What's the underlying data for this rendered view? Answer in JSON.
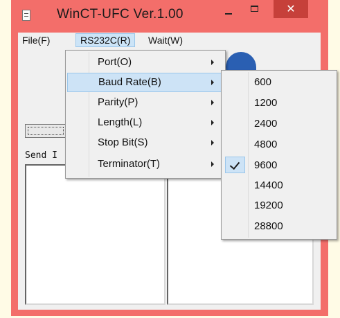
{
  "window": {
    "title": "WinCT-UFC  Ver.1.00",
    "close_glyph": "✕"
  },
  "menubar": {
    "items": [
      "File(F)",
      "RS232C(R)",
      "Wait(W)"
    ]
  },
  "main": {
    "send_label": "Send I"
  },
  "rs232c_menu": {
    "items": [
      "Port(O)",
      "Baud Rate(B)",
      "Parity(P)",
      "Length(L)",
      "Stop Bit(S)",
      "Terminator(T)"
    ],
    "highlighted": "Baud Rate(B)"
  },
  "baud_menu": {
    "items": [
      "600",
      "1200",
      "2400",
      "4800",
      "9600",
      "14400",
      "19200",
      "28800"
    ],
    "selected": "9600"
  },
  "colors": {
    "window_frame": "#f36e6a",
    "close_button": "#c6403a",
    "highlight": "#cde3f6",
    "graphic": "#2a5fb2"
  },
  "icons": [
    "app-icon",
    "minimize-icon",
    "maximize-icon",
    "close-icon",
    "chevron-right-icon",
    "checkmark-icon"
  ]
}
